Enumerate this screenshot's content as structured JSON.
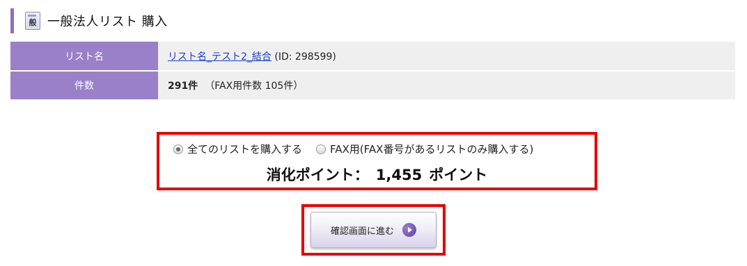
{
  "header": {
    "icon_text": "般",
    "title": "一般法人リスト 購入"
  },
  "info": {
    "list_name_label": "リスト名",
    "list_name_link": "リスト名_テスト2_結合",
    "list_id_text": " (ID: 298599)",
    "count_label": "件数",
    "count_value": "291件",
    "fax_count_text": "（FAX用件数 105件）"
  },
  "purchase": {
    "option_all": "全てのリストを購入する",
    "option_fax": "FAX用(FAX番号があるリストのみ購入する)",
    "selected": "option_all",
    "points_label": "消化ポイント：",
    "points_value": "1,455",
    "points_unit": "ポイント"
  },
  "actions": {
    "confirm_label": "確認画面に進む"
  },
  "colors": {
    "accent": "#9a80c8",
    "highlight_border": "#e60000",
    "link": "#1a3fd1"
  }
}
